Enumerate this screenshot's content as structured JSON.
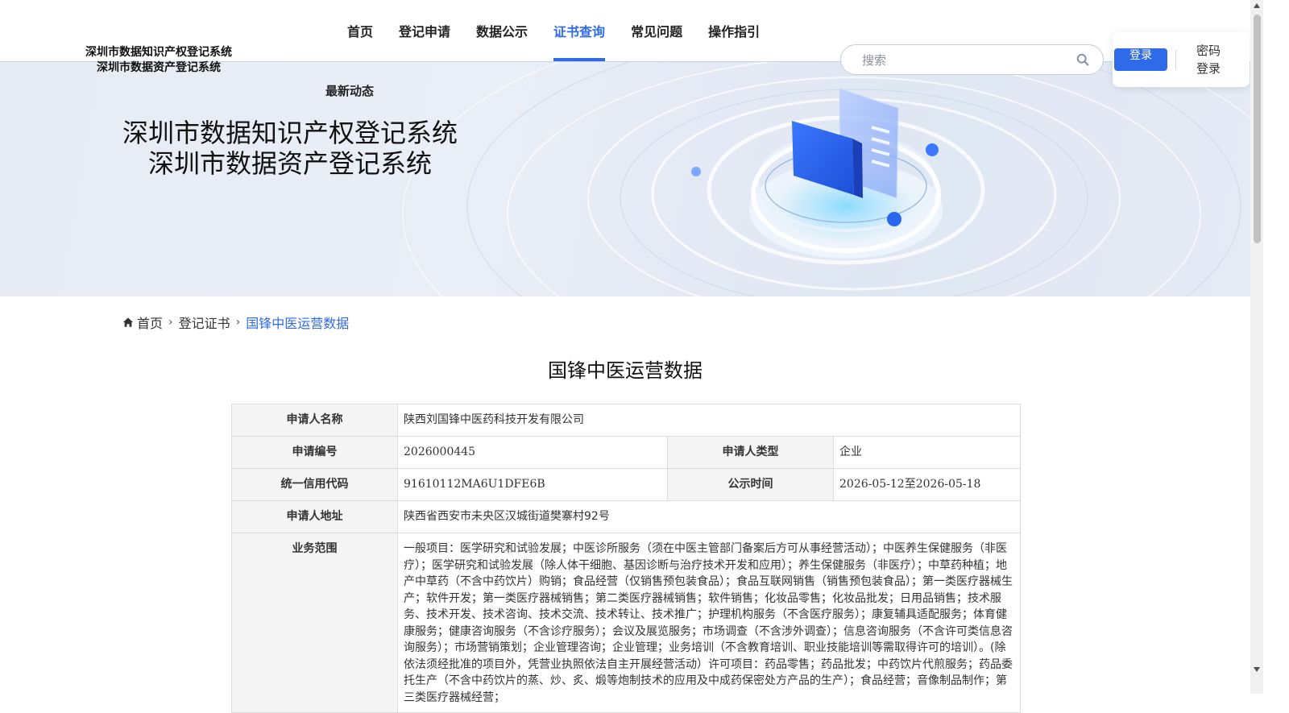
{
  "header": {
    "logo_line1": "深圳市数据知识产权登记系统",
    "logo_line2": "深圳市数据资产登记系统",
    "nav": [
      {
        "label": "首页"
      },
      {
        "label": "登记申请"
      },
      {
        "label": "数据公示"
      },
      {
        "label": "证书查询"
      },
      {
        "label": "常见问题"
      },
      {
        "label": "操作指引"
      }
    ],
    "active_nav": "证书查询",
    "search_placeholder": "搜索",
    "login_button": "登录",
    "password_login": "密码登录"
  },
  "banner": {
    "news_label": "最新动态",
    "title_line1": "深圳市数据知识产权登记系统",
    "title_line2": "深圳市数据资产登记系统"
  },
  "breadcrumb": {
    "home": "首页",
    "section": "登记证书",
    "current": "国锋中医运营数据"
  },
  "page_title": "国锋中医运营数据",
  "details": {
    "applicant_name_label": "申请人名称",
    "applicant_name": "陕西刘国锋中医药科技开发有限公司",
    "application_no_label": "申请编号",
    "application_no": "2026000445",
    "applicant_type_label": "申请人类型",
    "applicant_type": "企业",
    "credit_code_label": "统一信用代码",
    "credit_code": "91610112MA6U1DFE6B",
    "publicity_period_label": "公示时间",
    "publicity_period": "2026-05-12至2026-05-18",
    "address_label": "申请人地址",
    "address": "陕西省西安市未央区汉城街道樊寨村92号",
    "business_scope_label": "业务范围",
    "business_scope": "一般项目：医学研究和试验发展；中医诊所服务（须在中医主管部门备案后方可从事经营活动）；中医养生保健服务（非医疗）；医学研究和试验发展（除人体干细胞、基因诊断与治疗技术开发和应用）；养生保健服务（非医疗）；中草药种植；地产中草药（不含中药饮片）购销；食品经营（仅销售预包装食品）；食品互联网销售（销售预包装食品）；第一类医疗器械生产；软件开发；第一类医疗器械销售；第二类医疗器械销售；软件销售；化妆品零售；化妆品批发；日用品销售；技术服务、技术开发、技术咨询、技术交流、技术转让、技术推广；护理机构服务（不含医疗服务）；康复辅具适配服务；体育健康服务；健康咨询服务（不含诊疗服务）；会议及展览服务；市场调查（不含涉外调查）；信息咨询服务（不含许可类信息咨询服务）；市场营销策划；企业管理咨询；企业管理；业务培训（不含教育培训、职业技能培训等需取得许可的培训）。(除依法须经批准的项目外，凭营业执照依法自主开展经营活动）许可项目：药品零售；药品批发；中药饮片代煎服务；药品委托生产（不含中药饮片的蒸、炒、炙、煅等炮制技术的应用及中成药保密处方产品的生产）；食品经营；音像制品制作；第三类医疗器械经营；"
  },
  "colors": {
    "accent": "#2f6ae8",
    "label_bg": "#f4f4f4",
    "border": "#dcdcdc"
  }
}
